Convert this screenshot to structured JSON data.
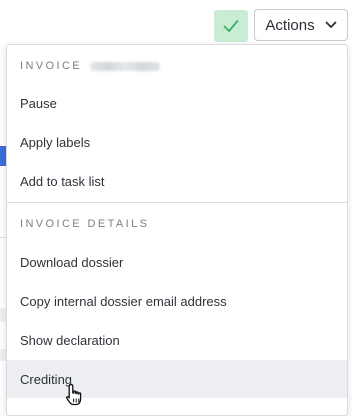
{
  "toolbar": {
    "confirm_icon": "check-icon",
    "actions_label": "Actions",
    "actions_icon": "chevron-down-icon"
  },
  "menu": {
    "sections": [
      {
        "header": "INVOICE",
        "header_suffix_obscured": true,
        "items": [
          "Pause",
          "Apply labels",
          "Add to task list"
        ]
      },
      {
        "header": "INVOICE DETAILS",
        "items": [
          "Download dossier",
          "Copy internal dossier email address",
          "Show declaration",
          "Crediting"
        ]
      }
    ],
    "hovered_item": "Crediting"
  },
  "colors": {
    "confirm_bg": "#c9ecd4",
    "confirm_icon": "#3fae5e",
    "hover_bg": "#eceef1",
    "header_text": "#7a7f87"
  },
  "cursor": "hand-pointer-icon"
}
